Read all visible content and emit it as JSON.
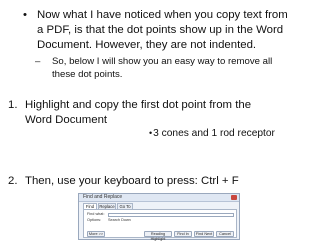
{
  "bullet_marker": "•",
  "dash_marker": "–",
  "bullet_lines": [
    "Now what I have noticed when you copy text from",
    "a PDF, is that the dot points show up in the Word",
    "Document. However, they are not indented."
  ],
  "sub_lines": [
    "So, below I will show you an easy way to remove all",
    "these dot points."
  ],
  "step1": {
    "number": "1.",
    "lines": [
      "Highlight and copy the first dot point from the",
      "Word Document"
    ]
  },
  "snippet": {
    "dot": "•",
    "text": "3 cones and 1 rod receptor"
  },
  "step2": {
    "number": "2.",
    "text": "Then, use your keyboard to press: Ctrl + F"
  },
  "dialog": {
    "title": "Find and Replace",
    "tabs": [
      "Find",
      "Replace",
      "Go To"
    ],
    "find_label": "Find what:",
    "options_label": "Options:",
    "options_value": "Search Down",
    "more_button": "More >>",
    "reading_highlight_button": "Reading Highlight",
    "find_in_button": "Find In",
    "find_next_button": "Find Next",
    "cancel_button": "Cancel"
  }
}
